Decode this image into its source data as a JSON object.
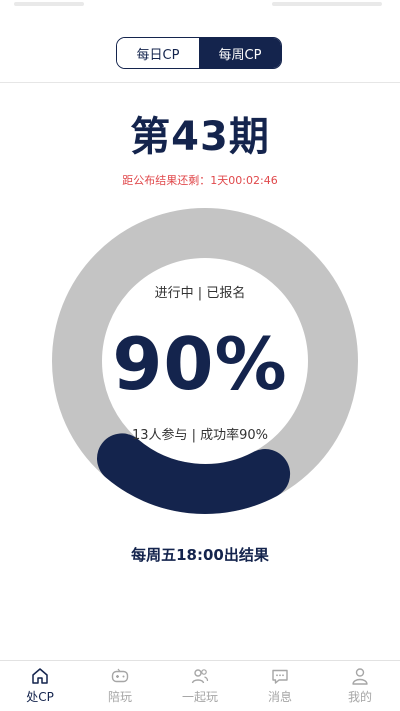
{
  "segmented": {
    "daily_label": "每日CP",
    "weekly_label": "每周CP",
    "active": "weekly"
  },
  "period": {
    "title": "第43期"
  },
  "countdown": {
    "text": "距公布结果还剩：1天00:02:46"
  },
  "ring": {
    "status_text": "进行中 | 已报名",
    "percent_text": "90%",
    "stats_text": "13人参与 | 成功率90%",
    "progress_fraction": 0.19
  },
  "result_note": {
    "text": "每周五18:00出结果"
  },
  "tabbar": {
    "items": [
      {
        "label": "处CP",
        "icon": "home-icon",
        "active": true
      },
      {
        "label": "陪玩",
        "icon": "gamepad-icon",
        "active": false
      },
      {
        "label": "一起玩",
        "icon": "users-icon",
        "active": false
      },
      {
        "label": "消息",
        "icon": "message-icon",
        "active": false
      },
      {
        "label": "我的",
        "icon": "profile-icon",
        "active": false
      }
    ]
  },
  "colors": {
    "primary": "#14244d",
    "ring_track": "#c4c4c4",
    "countdown": "#e0484b",
    "inactive_tab": "#a6a6a6"
  }
}
